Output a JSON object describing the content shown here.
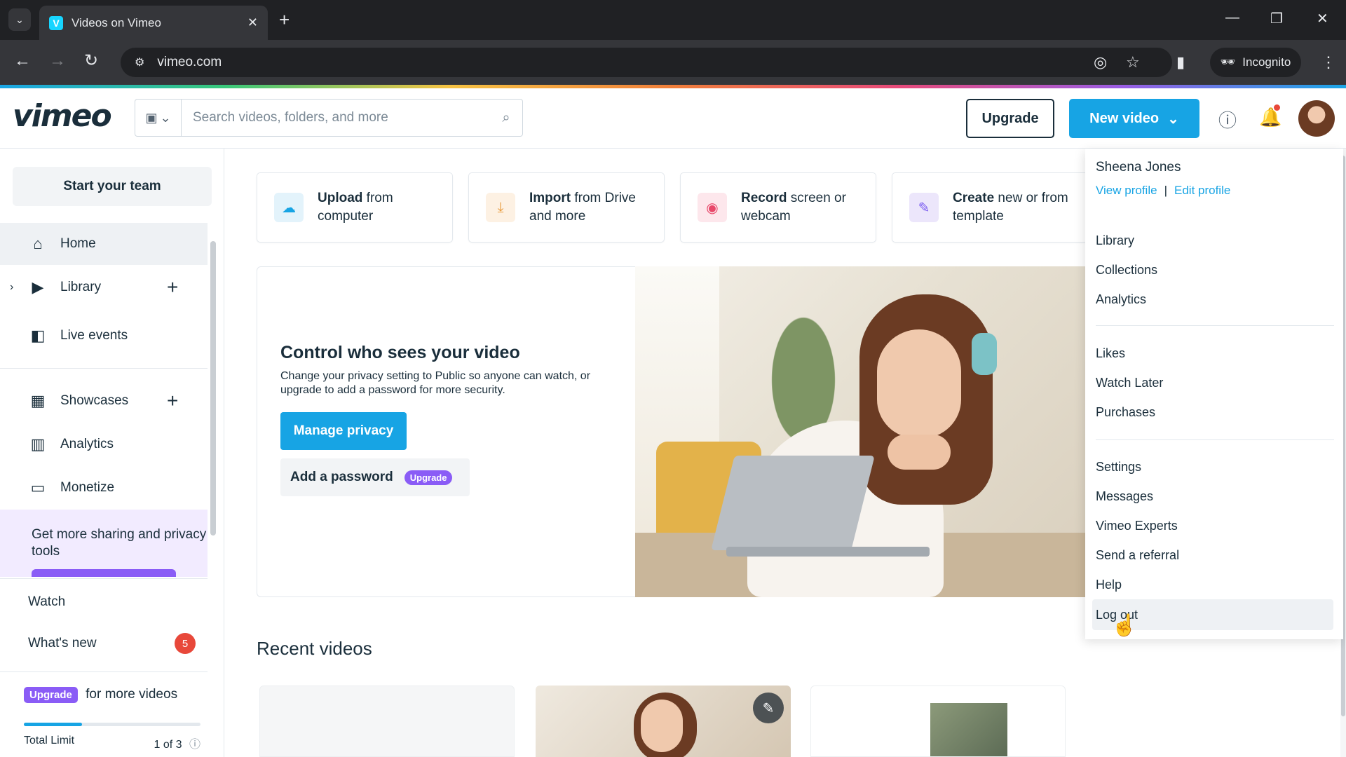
{
  "browser": {
    "tab_title": "Videos on Vimeo",
    "url": "vimeo.com",
    "incognito_label": "Incognito"
  },
  "header": {
    "logo": "vimeo",
    "search_placeholder": "Search videos, folders, and more",
    "upgrade_label": "Upgrade",
    "new_video_label": "New video"
  },
  "sidebar": {
    "team_button": "Start your team",
    "items": [
      {
        "label": "Home",
        "icon": "home-icon"
      },
      {
        "label": "Library",
        "icon": "library-icon"
      },
      {
        "label": "Live events",
        "icon": "camera-icon"
      },
      {
        "label": "Showcases",
        "icon": "showcases-icon"
      },
      {
        "label": "Analytics",
        "icon": "analytics-icon"
      },
      {
        "label": "Monetize",
        "icon": "monetize-icon"
      }
    ],
    "promo_text": "Get more sharing and privacy tools",
    "watch_label": "Watch",
    "whats_new_label": "What's new",
    "whats_new_count": "5",
    "upgrade_pill": "Upgrade",
    "more_videos_text": "for more videos",
    "limit_label": "Total Limit",
    "limit_value": "1 of 3",
    "limit_fraction": 0.33
  },
  "actions": [
    {
      "bold": "Upload",
      "rest": " from computer",
      "icon": "upload-cloud-icon"
    },
    {
      "bold": "Import",
      "rest": " from Drive and more",
      "icon": "download-icon"
    },
    {
      "bold": "Record",
      "rest": " screen or webcam",
      "icon": "record-icon"
    },
    {
      "bold": "Create",
      "rest": " new or from template",
      "icon": "create-icon"
    }
  ],
  "hero": {
    "title": "Control who sees your video",
    "subtitle": "Change your privacy setting to Public so anyone can watch, or upgrade to add a password for more security.",
    "manage_button": "Manage privacy",
    "password_button": "Add a password",
    "password_badge": "Upgrade"
  },
  "recent": {
    "title": "Recent videos"
  },
  "menu": {
    "user_name": "Sheena Jones",
    "view_profile": "View profile",
    "separator": "|",
    "edit_profile": "Edit profile",
    "group1": [
      "Library",
      "Collections",
      "Analytics"
    ],
    "group2": [
      "Likes",
      "Watch Later",
      "Purchases"
    ],
    "group3": [
      "Settings",
      "Messages",
      "Vimeo Experts",
      "Send a referral",
      "Help",
      "Log out"
    ]
  },
  "colors": {
    "brand_blue": "#17a4e4",
    "upgrade_purple": "#8a5cf6",
    "alert_red": "#e8483a"
  }
}
